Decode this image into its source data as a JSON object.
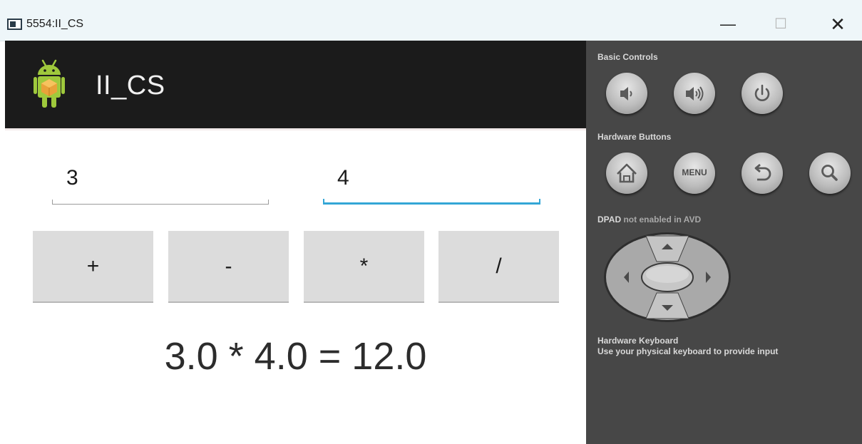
{
  "window": {
    "title": "5554:II_CS",
    "controls": {
      "minimize": "—",
      "maximize": "☐",
      "close": "✕"
    }
  },
  "app": {
    "title": "II_CS",
    "icon": "android-icon",
    "inputs": {
      "first": "3",
      "second": "4"
    },
    "operators": [
      "+",
      "-",
      "*",
      "/"
    ],
    "result": "3.0 * 4.0 = 12.0"
  },
  "panel": {
    "basic_controls_label": "Basic Controls",
    "basic_controls": [
      "volume-down-icon",
      "volume-up-icon",
      "power-icon"
    ],
    "hardware_buttons_label": "Hardware Buttons",
    "hardware_buttons": [
      "home-icon",
      "menu-button",
      "back-icon",
      "search-icon"
    ],
    "menu_label": "MENU",
    "dpad_label_bold": "DPAD",
    "dpad_label_rest": " not enabled in AVD",
    "keyboard_title": "Hardware Keyboard",
    "keyboard_desc": "Use your physical keyboard to provide input"
  },
  "colors": {
    "action_bar": "#1b1b1b",
    "focus_accent": "#33a6d6",
    "panel_bg": "#474747",
    "button_bg": "#dcdcdc",
    "titlebar_bg": "#eef6f9"
  }
}
